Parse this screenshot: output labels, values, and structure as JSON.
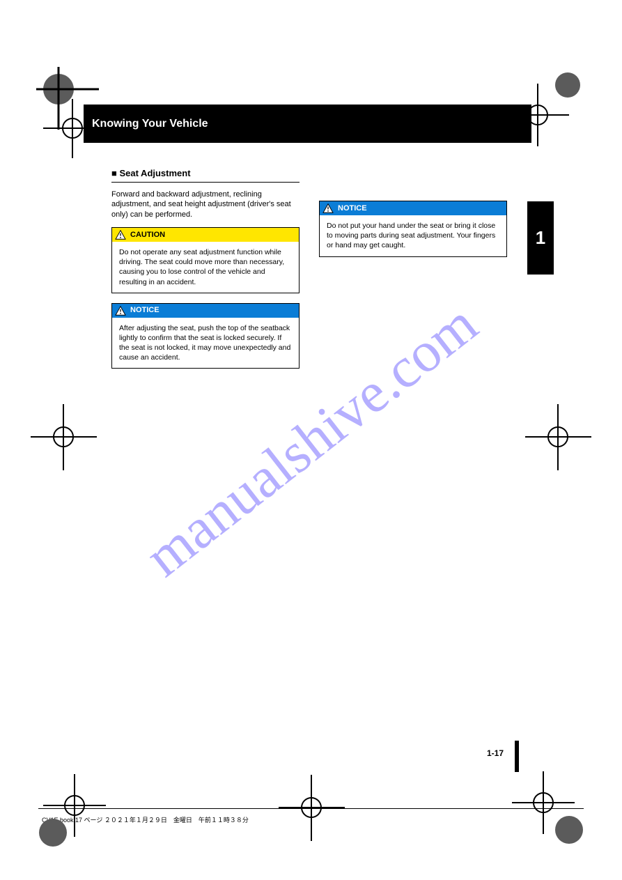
{
  "header": {
    "title": "Knowing Your Vehicle"
  },
  "sideTab": "1",
  "col1": {
    "heading": "■ Seat Adjustment",
    "intro": "Forward and backward adjustment, reclining adjustment, and seat height adjustment (driver's seat only) can be performed.",
    "caution": {
      "label": "CAUTION",
      "body": "Do not operate any seat adjustment function while driving. The seat could move more than necessary, causing you to lose control of the vehicle and resulting in an accident."
    },
    "notice1": {
      "label": "NOTICE",
      "body": "After adjusting the seat, push the top of the seatback lightly to confirm that the seat is locked securely. If the seat is not locked, it may move unexpectedly and cause an accident."
    }
  },
  "col2": {
    "notice2": {
      "label": "NOTICE",
      "body": "Do not put your hand under the seat or bring it close to moving parts during seat adjustment. Your fingers or hand may get caught."
    }
  },
  "pageNumber": "1-17",
  "footer": "CV1E.book  17 ページ  ２０２１年１月２９日　金曜日　午前１１時３８分"
}
